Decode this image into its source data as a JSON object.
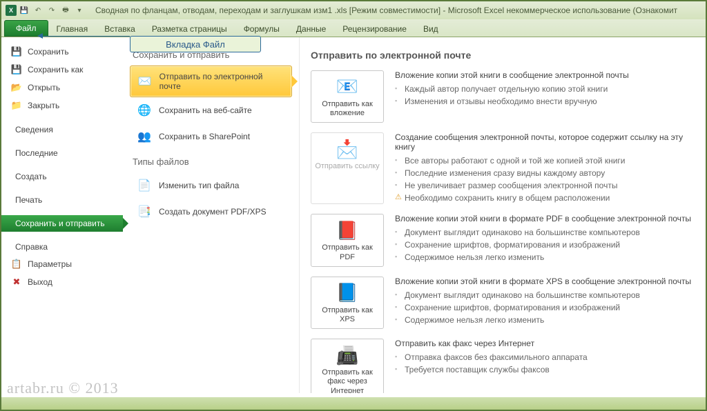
{
  "titlebar": {
    "doc_title": "Сводная по фланцам, отводам, переходам и заглушкам изм1 .xls  [Режим совместимости] - Microsoft Excel некоммерческое использование (Ознакомит"
  },
  "ribbon": {
    "file": "Файл",
    "tabs": [
      "Главная",
      "Вставка",
      "Разметка страницы",
      "Формулы",
      "Данные",
      "Рецензирование",
      "Вид"
    ]
  },
  "callout": {
    "text": "Вкладка Файл"
  },
  "left": {
    "save": "Сохранить",
    "save_as": "Сохранить как",
    "open": "Открыть",
    "close": "Закрыть",
    "info": "Сведения",
    "recent": "Последние",
    "new": "Создать",
    "print": "Печать",
    "save_send": "Сохранить и отправить",
    "help": "Справка",
    "options": "Параметры",
    "exit": "Выход"
  },
  "mid": {
    "head1": "Сохранить и отправить",
    "send_email": "Отправить по электронной почте",
    "save_web": "Сохранить на веб-сайте",
    "save_sp": "Сохранить в SharePoint",
    "head2": "Типы файлов",
    "change_type": "Изменить тип файла",
    "create_pdf": "Создать документ PDF/XPS"
  },
  "right": {
    "heading": "Отправить по электронной почте",
    "opts": [
      {
        "btn": "Отправить как вложение",
        "title": "Вложение копии этой книги в сообщение электронной почты",
        "bullets": [
          "Каждый автор получает отдельную копию этой книги",
          "Изменения и отзывы необходимо внести вручную"
        ]
      },
      {
        "btn": "Отправить ссылку",
        "disabled": true,
        "title": "Создание сообщения электронной почты, которое содержит ссылку на эту книгу",
        "bullets": [
          "Все авторы работают с одной и той же копией этой книги",
          "Последние изменения сразу видны каждому автору",
          "Не увеличивает размер сообщения электронной почты"
        ],
        "warn": "Необходимо сохранить книгу в общем расположении"
      },
      {
        "btn": "Отправить как PDF",
        "title": "Вложение копии этой книги в формате PDF в сообщение электронной почты",
        "bullets": [
          "Документ выглядит одинаково на большинстве компьютеров",
          "Сохранение шрифтов, форматирования и изображений",
          "Содержимое нельзя легко изменить"
        ]
      },
      {
        "btn": "Отправить как XPS",
        "title": "Вложение копии этой книги в формате XPS в сообщение электронной почты",
        "bullets": [
          "Документ выглядит одинаково на большинстве компьютеров",
          "Сохранение шрифтов, форматирования и изображений",
          "Содержимое нельзя легко изменить"
        ]
      },
      {
        "btn": "Отправить как факс через Интернет",
        "title": "Отправить как факс через Интернет",
        "bullets": [
          "Отправка факсов без факсимильного аппарата",
          "Требуется поставщик службы факсов"
        ]
      }
    ]
  },
  "watermark": "artabr.ru © 2013"
}
